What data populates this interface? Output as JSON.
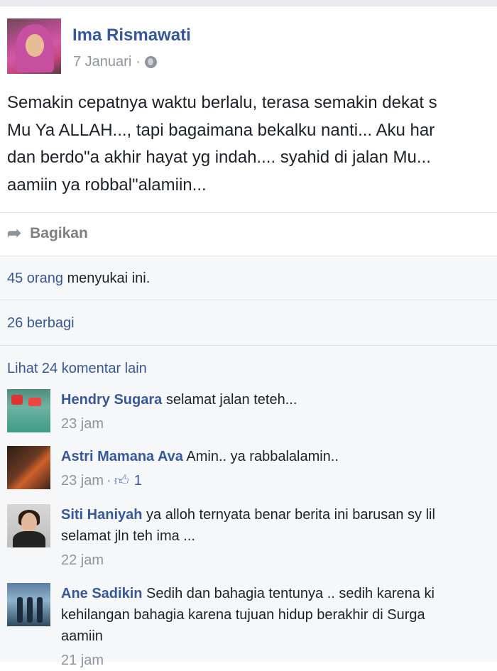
{
  "post": {
    "author": "Ima Rismawati",
    "date": "7 Januari",
    "separator": "·",
    "privacy_icon": "globe-icon",
    "text_lines": [
      "Semakin cepatnya waktu berlalu, terasa semakin dekat s",
      "Mu Ya ALLAH..., tapi bagaimana bekalku nanti... Aku har",
      "dan berdo\"a akhir hayat yg indah.... syahid di jalan Mu...",
      "aamiin ya robbal\"alamiin..."
    ]
  },
  "actions": {
    "share_label": "Bagikan",
    "share_icon": "share-arrow-icon"
  },
  "stats": {
    "likes_link": "45 orang",
    "likes_text": " menyukai ini.",
    "shares": "26 berbagi",
    "more_comments": "Lihat 24 komentar lain"
  },
  "comments": [
    {
      "name": "Hendry Sugara",
      "text": " selamat jalan teteh...",
      "lines": [],
      "time": "23 jam",
      "likes": ""
    },
    {
      "name": "Astri Mamana Ava",
      "text": " Amin.. ya rabbalalamin..",
      "lines": [],
      "time": "23 jam",
      "likes": "1"
    },
    {
      "name": "Siti Haniyah",
      "text": " ya alloh ternyata benar berita ini barusan sy lil",
      "lines": [
        "selamat jln teh ima ..."
      ],
      "time": "22 jam",
      "likes": ""
    },
    {
      "name": "Ane Sadikin",
      "text": " Sedih dan bahagia tentunya .. sedih karena ki",
      "lines": [
        "kehilangan bahagia karena tujuan hidup berakhir di Surga",
        "aamiin"
      ],
      "time": "21 jam",
      "likes": ""
    }
  ],
  "colors": {
    "link": "#365899",
    "muted": "#90949c",
    "background_gray": "#f6f7f9"
  }
}
